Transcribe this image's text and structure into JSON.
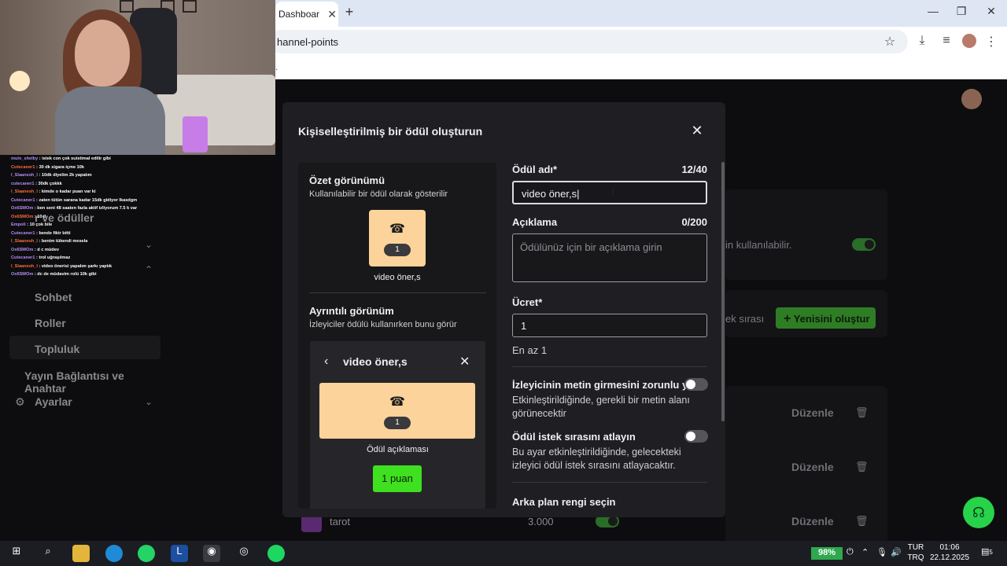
{
  "browser": {
    "tab_title": "Dashboar",
    "tab_close": "✕",
    "new_tab": "+",
    "url": "hannel-points",
    "bookmarks_text": "."
  },
  "background": {
    "sidebar": {
      "items": [
        {
          "label": "r ve ödüller"
        },
        {
          "label": "Sohbet"
        },
        {
          "label": "Roller"
        },
        {
          "label": "Topluluk"
        },
        {
          "label": "Yayın Bağlantısı ve Anahtar"
        },
        {
          "label": "Ayarlar"
        }
      ]
    },
    "usable_text": "in kullanılabilir.",
    "queue_text": "ek sırası",
    "create_button": "Yenisini oluştur",
    "edit_label": "Düzenle",
    "row": {
      "name": "tarot",
      "cost": "3.000"
    }
  },
  "modal": {
    "title": "Kişiselleştirilmiş bir ödül oluşturun",
    "preview": {
      "summary_heading": "Özet görünümü",
      "summary_sub": "Kullanılabilir bir ödül olarak gösterilir",
      "card_cost": "1",
      "card_name": "video öner,s",
      "detail_heading": "Ayrıntılı görünüm",
      "detail_sub": "İzleyiciler ödülü kullanırken bunu görür",
      "detail_title": "video öner,s",
      "detail_cost": "1",
      "detail_description": "Ödül açıklaması",
      "points_button": "1 puan"
    },
    "form": {
      "name_label": "Ödül adı*",
      "name_count": "12/40",
      "name_value": "video öner,s",
      "desc_label": "Açıklama",
      "desc_count": "0/200",
      "desc_placeholder": "Ödülünüz için bir açıklama girin",
      "cost_label": "Ücret*",
      "cost_value": "1",
      "cost_hint": "En az 1",
      "require_text_label": "İzleyicinin metin girmesini zorunlu yap",
      "require_text_desc": "Etkinleştirildiğinde, gerekli bir metin alanı görünecektir",
      "require_text_on": false,
      "skip_queue_label": "Ödül istek sırasını atlayın",
      "skip_queue_desc": "Bu ayar etkinleştirildiğinde, gelecekteki izleyici ödül istek sırasını atlayacaktır.",
      "skip_queue_on": false,
      "bg_color_label": "Arka plan rengi seçin"
    }
  },
  "chat": [
    {
      "user": "mulo_shelby",
      "msg": "istek con çok suistimal edilir gibi"
    },
    {
      "user": "Cutecaner1",
      "msg": "30 dk sigara içme 10k"
    },
    {
      "user": "l_Slaanesh_l",
      "msg": "10dk diyelim 2k yapalım"
    },
    {
      "user": "cutecaner1",
      "msg": "30dk çokkk"
    },
    {
      "user": "l_Slaanesh_l",
      "msg": "kimde o kadar puan var ki"
    },
    {
      "user": "Cutecaner1",
      "msg": "zaten tütün sarana kadar 15dk gidiyor lkasdgm"
    },
    {
      "user": "Ox6SMOm",
      "msg": "ben seni 48 saaten fazla aktif izliyorum 7.5 k var"
    },
    {
      "user": "Ox6SMOm",
      "msg": "10 tl"
    },
    {
      "user": "Empoli",
      "msg": "10 çok bile"
    },
    {
      "user": "Cutecaner1",
      "msg": "bende fikir bitti"
    },
    {
      "user": "l_Slaanesh_l",
      "msg": "benim tükendi mesela"
    },
    {
      "user": "Ox6SMOm",
      "msg": "d c müdev"
    },
    {
      "user": "Cutecaner1",
      "msg": "trol uğraşılmaz"
    },
    {
      "user": "l_Slaanesh_l",
      "msg": "video önerisi yapalım şarkı yaptık"
    },
    {
      "user": "Ox6SMOm",
      "msg": "dc de müdavim rolü 10k gibi"
    }
  ],
  "taskbar": {
    "battery": "98%",
    "lang_top": "TUR",
    "lang_bottom": "TRQ",
    "time": "01:06",
    "date": "22.12.2025",
    "notif_count": "5"
  },
  "colors": {
    "accent_green": "#3ee01f",
    "card_bg": "#fcd39a",
    "modal_bg": "#1f1f23"
  }
}
